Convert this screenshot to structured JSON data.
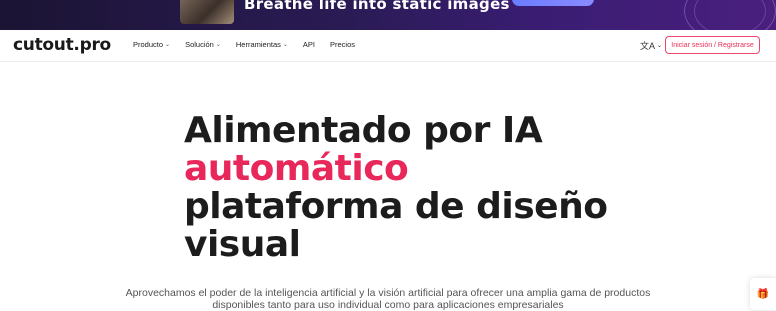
{
  "banner": {
    "headline": "Breathe life into static images"
  },
  "nav": {
    "logo": "cutout.pro",
    "menu": [
      {
        "label": "Producto",
        "has_dropdown": true
      },
      {
        "label": "Solución",
        "has_dropdown": true
      },
      {
        "label": "Herramientas",
        "has_dropdown": true
      },
      {
        "label": "API",
        "has_dropdown": false
      },
      {
        "label": "Precios",
        "has_dropdown": false
      }
    ],
    "language_icon": "translate-icon",
    "login_label": "Iniciar sesión / Registrarse"
  },
  "hero": {
    "line1": "Alimentado por IA",
    "line2": "automático",
    "line3": "plataforma de diseño",
    "line4": "visual",
    "description": "Aprovechamos el poder de la inteligencia artificial y la visión artificial para ofrecer una amplia gama de productos disponibles tanto para uso individual como para aplicaciones empresariales"
  },
  "floating": {
    "gift_icon": "gift-icon"
  },
  "colors": {
    "accent": "#e8275a",
    "banner_bg": "#2a1b55",
    "text": "#1c1c1c"
  }
}
